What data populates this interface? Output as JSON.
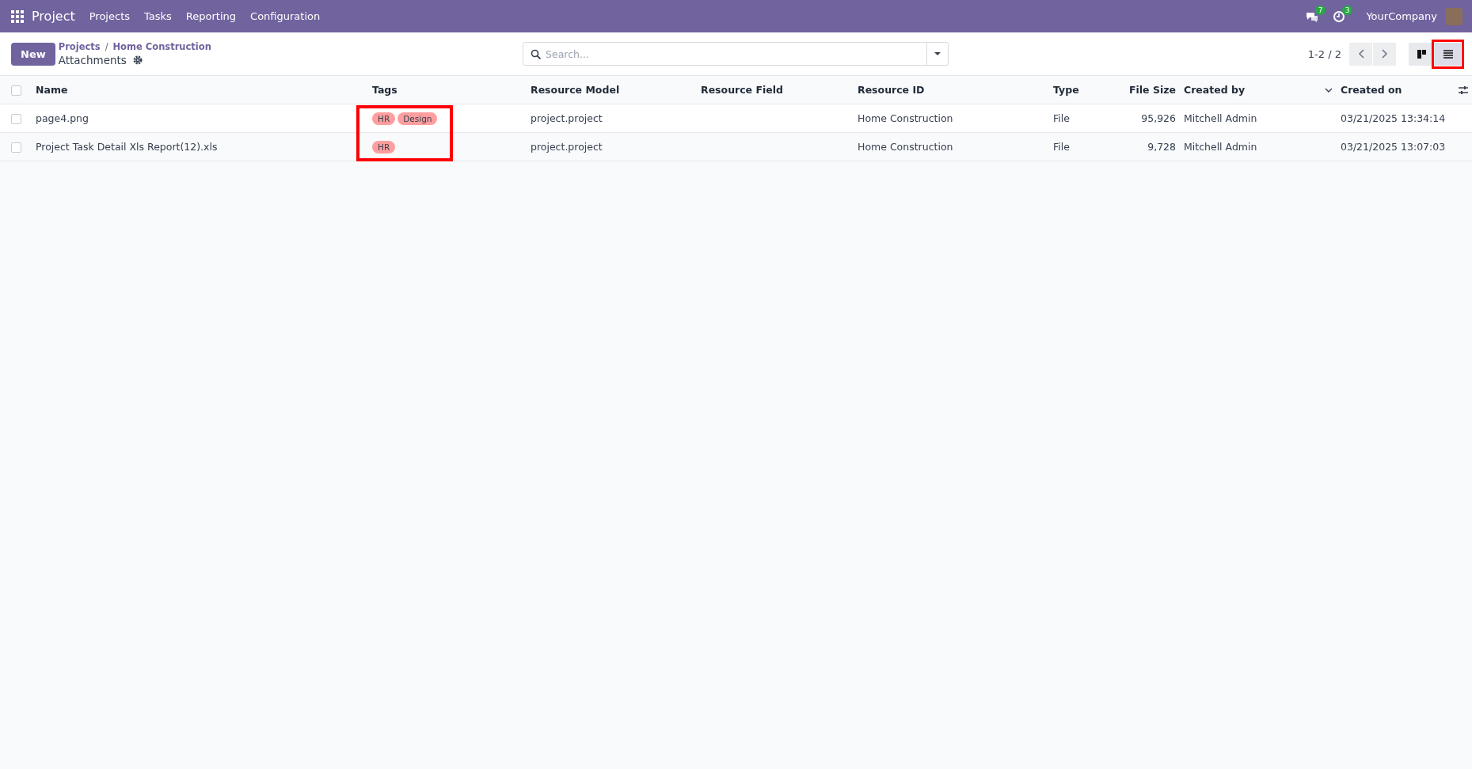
{
  "navbar": {
    "app": "Project",
    "menu": [
      "Projects",
      "Tasks",
      "Reporting",
      "Configuration"
    ],
    "messages_count": "7",
    "activities_count": "3",
    "company": "YourCompany"
  },
  "control_panel": {
    "new_button": "New",
    "breadcrumb": [
      "Projects",
      "Home Construction"
    ],
    "breadcrumb_separator": "/",
    "title": "Attachments",
    "search": {
      "placeholder": "Search..."
    },
    "pager": "1-2 / 2",
    "views": [
      {
        "kind": "kanban",
        "selected": false,
        "highlighted": false
      },
      {
        "kind": "list",
        "selected": true,
        "highlighted": true
      }
    ]
  },
  "table": {
    "all_checked": false,
    "tags_highlighted": true,
    "columns": [
      {
        "label": "Name",
        "kind": "text"
      },
      {
        "label": "Tags",
        "kind": "tags"
      },
      {
        "label": "Resource Model",
        "kind": "text"
      },
      {
        "label": "Resource Field",
        "kind": "text"
      },
      {
        "label": "Resource ID",
        "kind": "text"
      },
      {
        "label": "Type",
        "kind": "text"
      },
      {
        "label": "File Size",
        "kind": "number"
      },
      {
        "label": "Created by",
        "kind": "text",
        "sort_menu": true
      },
      {
        "label": "Created on",
        "kind": "text"
      }
    ],
    "rows": [
      {
        "checked": false,
        "cells": [
          "page4.png",
          [
            {
              "label": "HR",
              "color": "#ff9e9e"
            },
            {
              "label": "Design",
              "color": "#ff9e9e"
            }
          ],
          "project.project",
          "",
          "Home Construction",
          "File",
          "95,926",
          "Mitchell Admin",
          "03/21/2025 13:34:14"
        ]
      },
      {
        "checked": false,
        "cells": [
          "Project Task Detail Xls Report(12).xls",
          [
            {
              "label": "HR",
              "color": "#ff9e9e"
            }
          ],
          "project.project",
          "",
          "Home Construction",
          "File",
          "9,728",
          "Mitchell Admin",
          "03/21/2025 13:07:03"
        ]
      }
    ]
  }
}
